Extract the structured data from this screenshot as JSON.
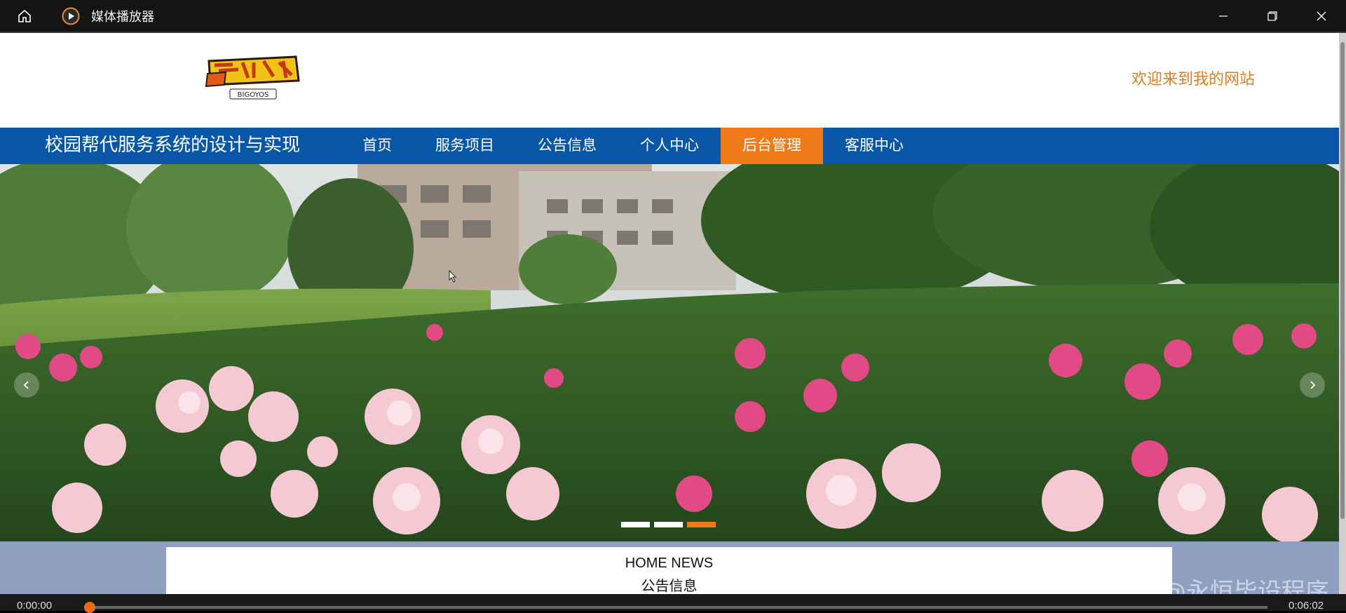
{
  "window": {
    "title": "媒体播放器",
    "icons": {
      "home": "home-icon",
      "app": "play-circle-icon",
      "minimize": "minimize-icon",
      "maximize": "restore-icon",
      "close": "close-icon"
    }
  },
  "site": {
    "logo_text": "BIGOYOS",
    "welcome": "欢迎来到我的网站",
    "title": "校园帮代服务系统的设计与实现",
    "nav": [
      {
        "label": "首页",
        "active": false
      },
      {
        "label": "服务项目",
        "active": false
      },
      {
        "label": "公告信息",
        "active": false
      },
      {
        "label": "个人中心",
        "active": false
      },
      {
        "label": "后台管理",
        "active": true
      },
      {
        "label": "客服中心",
        "active": false
      }
    ],
    "banner": {
      "slides": 3,
      "active_slide": 3
    },
    "news": {
      "heading_en": "HOME NEWS",
      "heading_cn": "公告信息"
    }
  },
  "watermark": "CSDN @永恒毕设程序",
  "player": {
    "current_time": "0:00:00",
    "total_time": "0:06:02",
    "progress": 0.0
  },
  "colors": {
    "nav_bg": "#0a57a8",
    "accent": "#ef7a18",
    "welcome": "#e07b1e"
  }
}
